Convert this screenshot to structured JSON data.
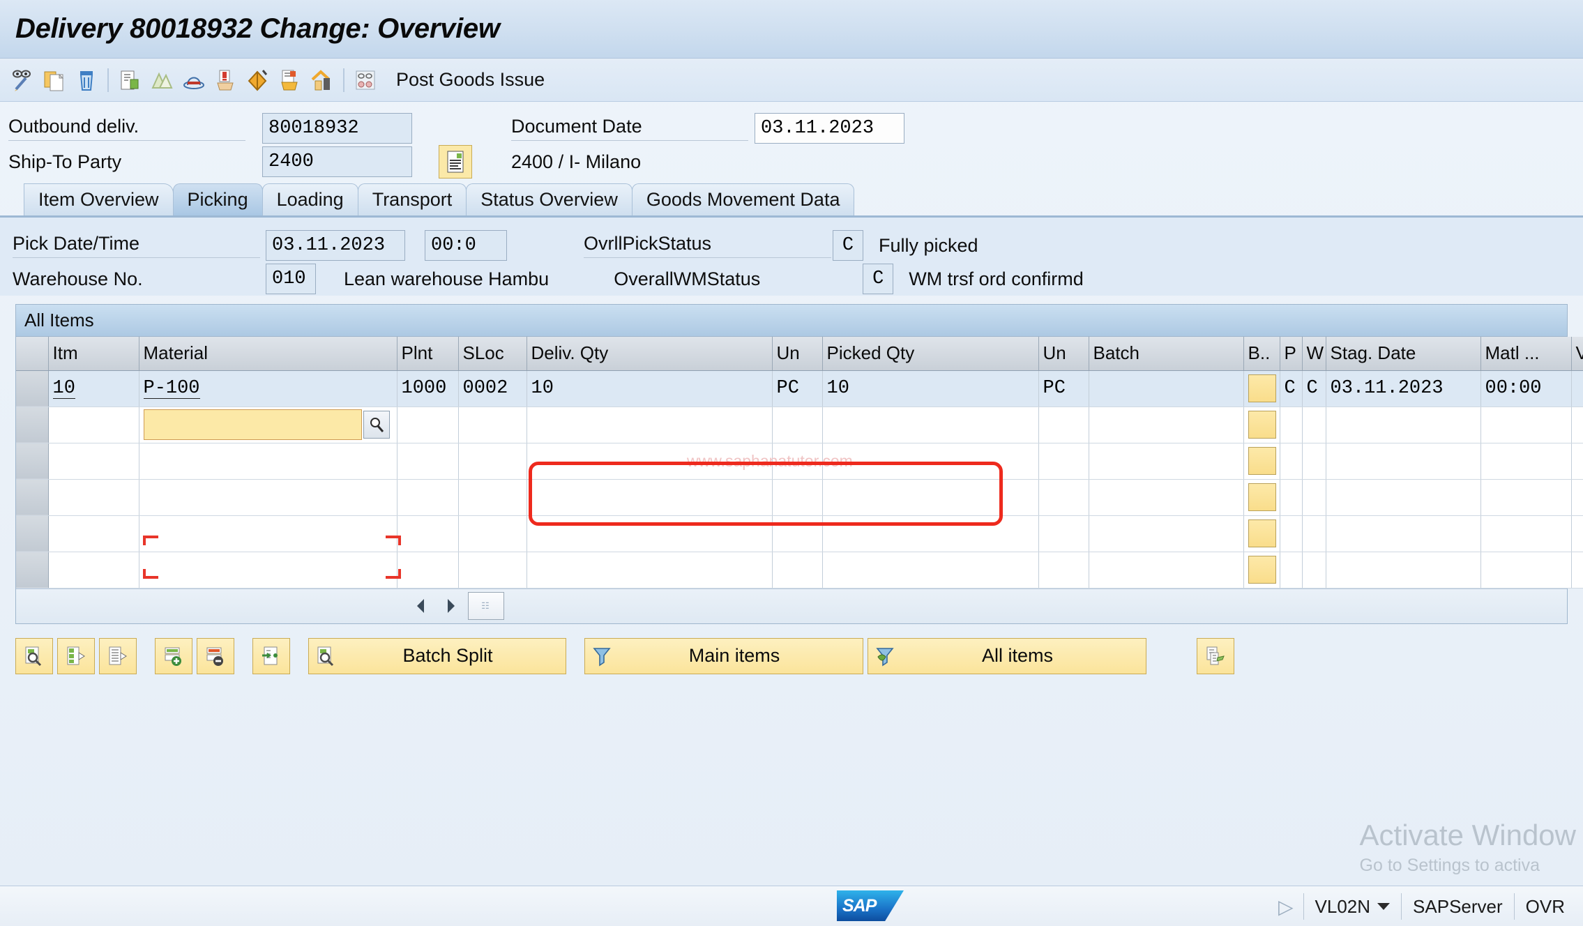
{
  "window": {
    "title": "Delivery 80018932 Change: Overview"
  },
  "toolbar": {
    "icons": [
      {
        "name": "display-change-icon",
        "label": "Display/Change"
      },
      {
        "name": "create-copy-icon",
        "label": "Other Delivery"
      },
      {
        "name": "delete-icon",
        "label": "Delete"
      },
      {
        "name": "document-flow-icon",
        "label": "Document Flow"
      },
      {
        "name": "packing-icon",
        "label": "Packing"
      },
      {
        "name": "hat-icon",
        "label": "Header Details"
      },
      {
        "name": "alert-icon",
        "label": "Incompletion Log"
      },
      {
        "name": "goods-issue-icon",
        "label": "Post Goods Issue"
      },
      {
        "name": "transfer-order-icon",
        "label": "Create Transfer Order"
      },
      {
        "name": "warehouse-home-icon",
        "label": "Warehouse"
      },
      {
        "name": "batch-determination-icon",
        "label": "Batch Determination"
      }
    ],
    "post_goods_issue_label": "Post Goods Issue"
  },
  "header": {
    "outbound_deliv_label": "Outbound deliv.",
    "outbound_deliv_value": "80018932",
    "ship_to_party_label": "Ship-To Party",
    "ship_to_party_value": "2400",
    "partner_detail_icon": "partner-details-icon",
    "ship_to_description": "2400 / I- Milano",
    "document_date_label": "Document Date",
    "document_date_value": "03.11.2023"
  },
  "tabs": [
    {
      "label": "Item Overview",
      "active": false
    },
    {
      "label": "Picking",
      "active": true
    },
    {
      "label": "Loading",
      "active": false
    },
    {
      "label": "Transport",
      "active": false
    },
    {
      "label": "Status Overview",
      "active": false
    },
    {
      "label": "Goods Movement Data",
      "active": false
    }
  ],
  "picking": {
    "pick_date_label": "Pick Date/Time",
    "pick_date_value": "03.11.2023",
    "pick_time_value": "00:0",
    "warehouse_label": "Warehouse No.",
    "warehouse_value": "010",
    "warehouse_description": "Lean warehouse Hambu",
    "ovrll_pick_status_label": "OvrllPickStatus",
    "ovrll_pick_status_value": "C",
    "ovrll_pick_status_text": "Fully picked",
    "overall_wm_status_label": "OverallWMStatus",
    "overall_wm_status_value": "C",
    "overall_wm_status_text": "WM trsf ord confirmd"
  },
  "table": {
    "title": "All Items",
    "columns": [
      {
        "key": "sel",
        "label": ""
      },
      {
        "key": "itm",
        "label": "Itm"
      },
      {
        "key": "material",
        "label": "Material"
      },
      {
        "key": "plnt",
        "label": "Plnt"
      },
      {
        "key": "sloc",
        "label": "SLoc"
      },
      {
        "key": "deliv_qty",
        "label": "Deliv. Qty"
      },
      {
        "key": "un1",
        "label": "Un"
      },
      {
        "key": "picked_qty",
        "label": "Picked Qty"
      },
      {
        "key": "un2",
        "label": "Un"
      },
      {
        "key": "batch",
        "label": "Batch"
      },
      {
        "key": "b",
        "label": "B.."
      },
      {
        "key": "p",
        "label": "P"
      },
      {
        "key": "w",
        "label": "W"
      },
      {
        "key": "stag_date",
        "label": "Stag. Date"
      },
      {
        "key": "matl",
        "label": "Matl ..."
      },
      {
        "key": "val",
        "label": "Val."
      }
    ],
    "rows": [
      {
        "itm": "10",
        "material": "P-100",
        "plnt": "1000",
        "sloc": "0002",
        "deliv_qty": "10",
        "un1": "PC",
        "picked_qty": "10",
        "un2": "PC",
        "batch": "",
        "b": "",
        "p": "C",
        "w": "C",
        "stag_date": "03.11.2023",
        "matl": "00:00",
        "val": ""
      }
    ],
    "empty_row_count": 5,
    "active_cell": {
      "column": "material",
      "value": "",
      "f4_icon": "search-help-icon"
    },
    "footer": {
      "prev_icon": "arrow-left-icon",
      "next_icon": "arrow-right-icon",
      "config_icon": "table-settings-icon"
    },
    "highlight_color": "#ee2a1d"
  },
  "bottom_toolbar": [
    {
      "name": "display-item-details-button",
      "icon": "magnify-list-icon",
      "label": ""
    },
    {
      "name": "item-details-button",
      "icon": "list-arrow-icon",
      "label": ""
    },
    {
      "name": "item-list-button",
      "icon": "lines-arrow-icon",
      "label": ""
    },
    {
      "name": "insert-item-button",
      "icon": "insert-row-icon",
      "label": ""
    },
    {
      "name": "delete-item-button",
      "icon": "delete-row-icon",
      "label": ""
    },
    {
      "name": "copy-item-button",
      "icon": "duplicate-icon",
      "label": ""
    },
    {
      "name": "batch-split-button",
      "icon": "magnify-list-icon",
      "label": "Batch Split"
    },
    {
      "name": "main-items-button",
      "icon": "filter-icon",
      "label": "Main items"
    },
    {
      "name": "all-items-button",
      "icon": "filter-all-icon",
      "label": "All items"
    },
    {
      "name": "document-money-button",
      "icon": "document-money-icon",
      "label": ""
    }
  ],
  "watermarks": {
    "site": "www.saphanatutor.com",
    "activate_line1": "Activate Window",
    "activate_line2": "Go to Settings to activa"
  },
  "statusbar": {
    "logo": "SAP",
    "transaction": "VL02N",
    "server": "SAPServer",
    "mode": "OVR",
    "arrow_icon": "status-arrow-icon",
    "caret_icon": "caret-down-icon"
  }
}
